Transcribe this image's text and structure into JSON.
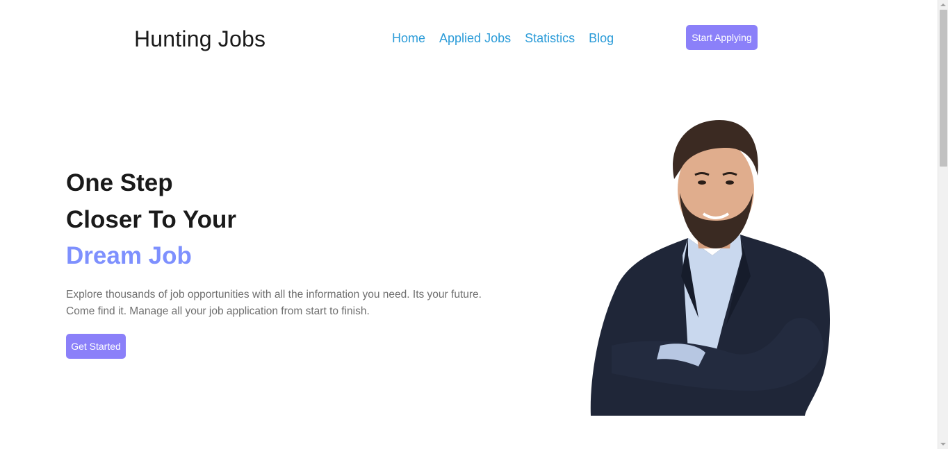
{
  "header": {
    "brand": "Hunting Jobs",
    "nav": [
      {
        "label": "Home"
      },
      {
        "label": "Applied Jobs"
      },
      {
        "label": "Statistics"
      },
      {
        "label": "Blog"
      }
    ],
    "cta_label": "Start Applying"
  },
  "hero": {
    "title_line1": "One Step",
    "title_line2": "Closer To Your",
    "title_accent": "Dream Job",
    "description": "Explore thousands of job opportunities with all the information you need. Its your future. Come find it. Manage all your job application from start to finish.",
    "button_label": "Get Started"
  },
  "colors": {
    "accent": "#7e90fe",
    "button": "#8b80f9",
    "nav_link": "#2a9bd8"
  },
  "icons": {
    "hero_image": "businessman-photo"
  }
}
